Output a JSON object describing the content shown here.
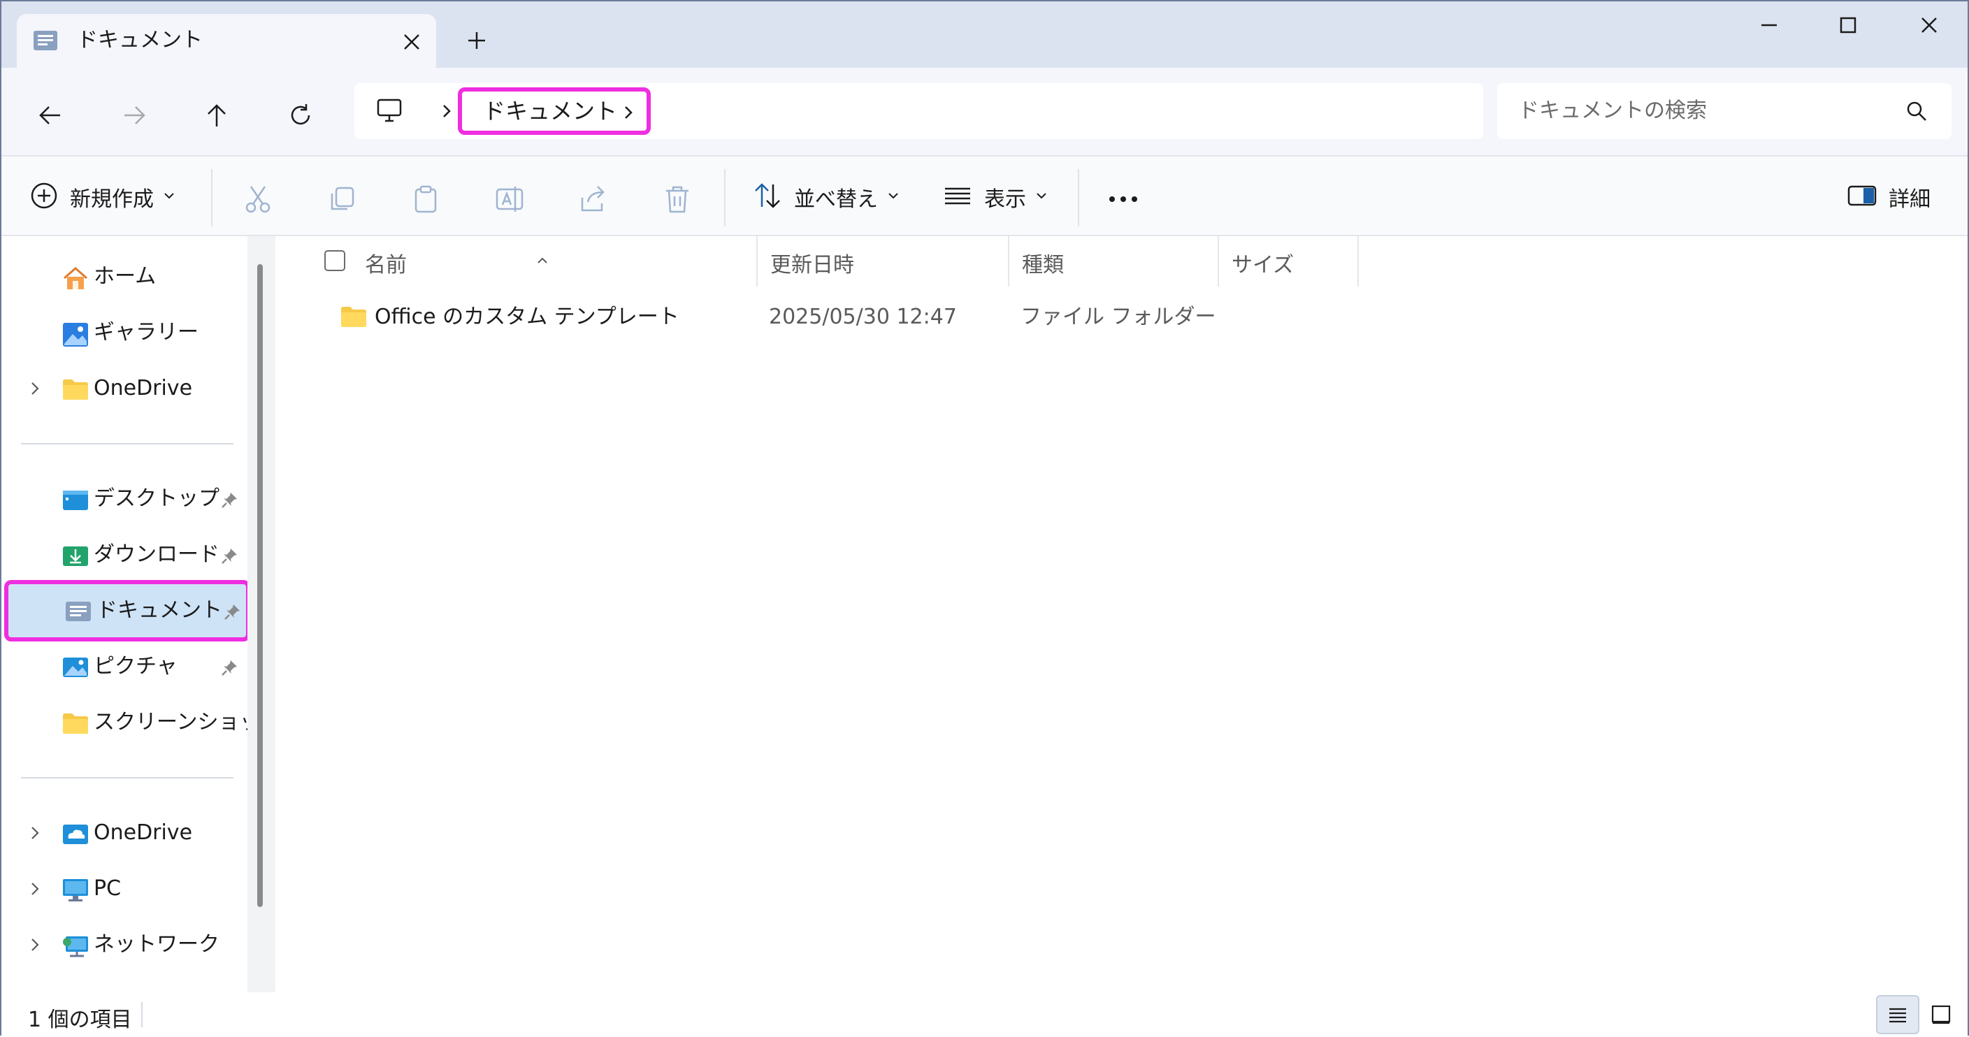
{
  "tab": {
    "label": "ドキュメント",
    "icon": "documents-folder-icon"
  },
  "window_controls": {
    "minimize": "minimize-icon",
    "maximize": "maximize-icon",
    "close": "close-icon"
  },
  "nav": {
    "back": "arrow-left-icon",
    "forward": "arrow-right-icon",
    "up": "arrow-up-icon",
    "refresh": "refresh-icon"
  },
  "address": {
    "root_icon": "this-pc-icon",
    "current": "ドキュメント"
  },
  "search": {
    "placeholder": "ドキュメントの検索"
  },
  "toolbar": {
    "new_label": "新規作成",
    "sort_label": "並べ替え",
    "view_label": "表示",
    "details_label": "詳細"
  },
  "sidebar": {
    "quick": [
      {
        "label": "ホーム",
        "icon": "home-icon"
      },
      {
        "label": "ギャラリー",
        "icon": "gallery-icon"
      },
      {
        "label": "OneDrive",
        "icon": "folder-icon",
        "expandable": true
      }
    ],
    "pinned": [
      {
        "label": "デスクトップ",
        "icon": "desktop-folder-icon",
        "pinned": true
      },
      {
        "label": "ダウンロード",
        "icon": "downloads-folder-icon",
        "pinned": true
      },
      {
        "label": "ドキュメント",
        "icon": "documents-folder-icon",
        "pinned": true,
        "selected": true
      },
      {
        "label": "ピクチャ",
        "icon": "pictures-folder-icon",
        "pinned": true
      },
      {
        "label": "スクリーンショット",
        "icon": "folder-icon",
        "pinned": false
      }
    ],
    "locations": [
      {
        "label": "OneDrive",
        "icon": "onedrive-cloud-icon",
        "expandable": true
      },
      {
        "label": "PC",
        "icon": "this-pc-icon",
        "expandable": true
      },
      {
        "label": "ネットワーク",
        "icon": "network-icon",
        "expandable": true
      }
    ]
  },
  "table": {
    "columns": [
      "名前",
      "更新日時",
      "種類",
      "サイズ"
    ],
    "rows": [
      {
        "name": "Office のカスタム テンプレート",
        "modified": "2025/05/30 12:47",
        "type": "ファイル フォルダー",
        "size": ""
      }
    ]
  },
  "status": {
    "count": "1 個の項目"
  },
  "colors": {
    "accent": "#0067c0",
    "highlight": "#ef2ee0",
    "selected_bg": "#cfe3f7",
    "folder": "#f7c948"
  }
}
